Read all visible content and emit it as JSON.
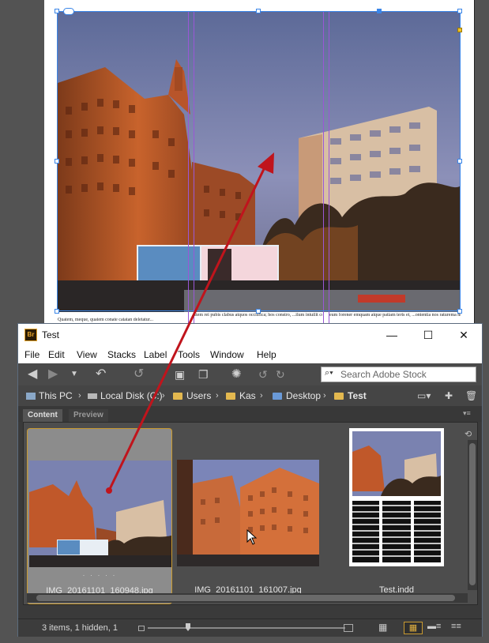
{
  "window": {
    "app_icon": "Br",
    "title": "Test",
    "minimize_glyph": "—",
    "maximize_glyph": "☐",
    "close_glyph": "✕"
  },
  "menu": [
    "File",
    "Edit",
    "View",
    "Stacks",
    "Label",
    "Tools",
    "Window",
    "Help"
  ],
  "toolbar": {
    "search_placeholder": "Search Adobe Stock"
  },
  "breadcrumbs": [
    "This PC",
    "Local Disk (C:)",
    "Users",
    "Kas",
    "Desktop",
    "Test"
  ],
  "panel_tabs": [
    "Content",
    "Preview"
  ],
  "thumbnails": [
    {
      "name": "IMG_20161101_160948.jpg",
      "rating": "· · · · ·",
      "selected": true
    },
    {
      "name": "IMG_20161101_161007.jpg",
      "selected": false
    },
    {
      "name": "Test.indd",
      "selected": false
    }
  ],
  "status": {
    "text": "3 items, 1 hidden, 1"
  },
  "document": {
    "text_left": "Quatem, meque, quatem conate catatan deletatur...",
    "text_mid": "Item rei pubis clabus atquos occisfica; hos constro, ...ilum intuilit conceti",
    "text_right": "eum forener emquam atque patiam terts et, ...ontentia nos raturema ne mauriaus"
  },
  "colors": {
    "accent_blue": "#3b86e8",
    "guide_purple": "#9a57d6",
    "arrow_red": "#c0141c",
    "selected_thumb": "#8c8c8c",
    "folder_yellow": "#e3b84f"
  }
}
